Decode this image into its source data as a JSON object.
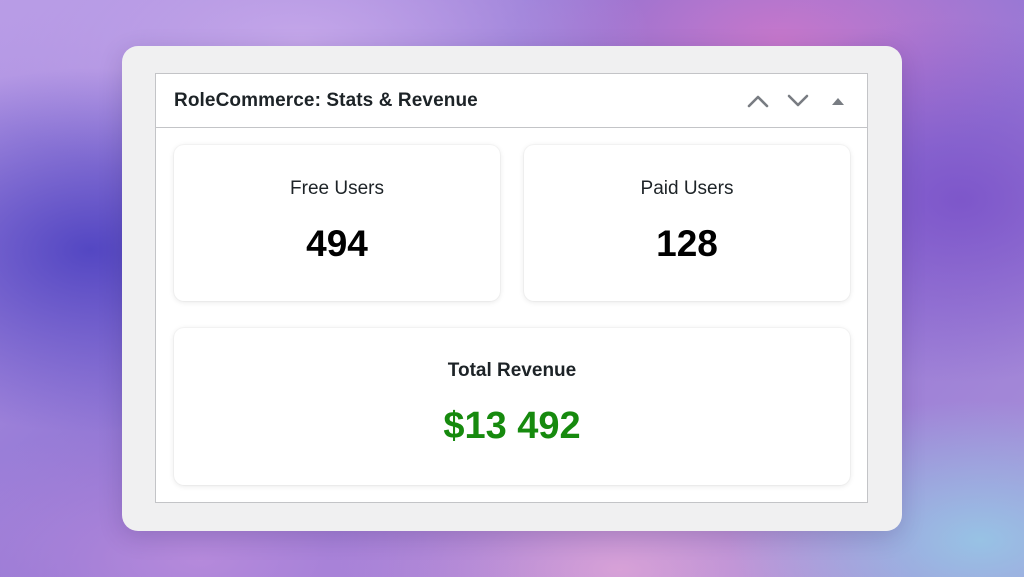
{
  "widget": {
    "title": "RoleCommerce: Stats & Revenue",
    "actions": [
      {
        "name": "move-up",
        "icon": "chevron-up-icon"
      },
      {
        "name": "move-down",
        "icon": "chevron-down-icon"
      },
      {
        "name": "toggle-panel",
        "icon": "triangle-up-icon"
      }
    ]
  },
  "stats": {
    "free_users": {
      "label": "Free Users",
      "value": "494"
    },
    "paid_users": {
      "label": "Paid Users",
      "value": "128"
    },
    "total_revenue": {
      "label": "Total Revenue",
      "value": "$13 492"
    }
  },
  "colors": {
    "revenue_value": "#168a0e",
    "icon": "#787c82",
    "border": "#c3c4c7"
  }
}
